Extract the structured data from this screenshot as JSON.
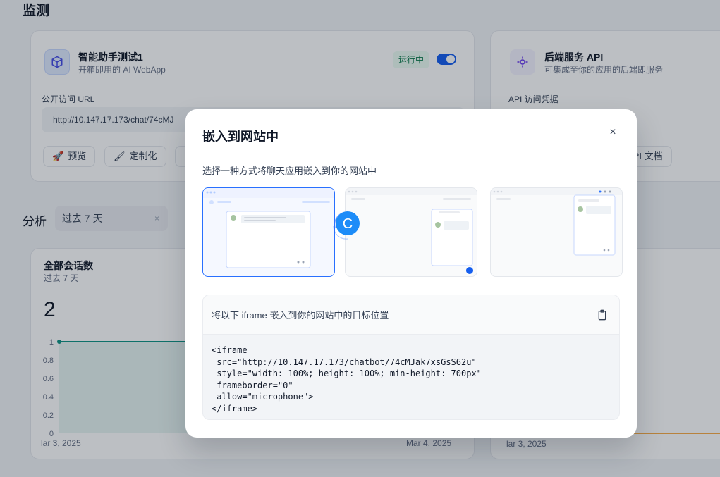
{
  "page": {
    "title": "监测"
  },
  "app_card": {
    "name": "智能助手测试1",
    "subtitle": "开箱即用的 AI WebApp",
    "status": "运行中",
    "url_label": "公开访问 URL",
    "url": "http://10.147.17.173/chat/74cMJ",
    "buttons": {
      "preview": "预览",
      "customize": "定制化"
    }
  },
  "api_card": {
    "name": "后端服务 API",
    "subtitle": "可集成至你的应用的后端即服务",
    "credentials_label": "API 访问凭据",
    "docs": "API 文档"
  },
  "analysis": {
    "label": "分析",
    "period": "过去 7 天",
    "clear": "×"
  },
  "chart_data": {
    "type": "line",
    "title": "全部会话数",
    "subtitle": "过去 7 天",
    "total": "2",
    "y_ticks": [
      "1",
      "0.8",
      "0.6",
      "0.4",
      "0.2",
      "0"
    ],
    "x_labels": [
      "lar 3, 2025",
      "Mar 4, 2025"
    ],
    "second_chart_x_label": "lar 3, 2025",
    "series": [
      {
        "values": [
          1,
          1
        ]
      }
    ],
    "ylim": [
      0,
      1
    ],
    "color": "#0e9384"
  },
  "loader": {
    "letter": "C"
  },
  "modal": {
    "title": "嵌入到网站中",
    "close": "×",
    "description": "选择一种方式将聊天应用嵌入到你的网站中",
    "options": [
      "fullscreen",
      "chat-bubble",
      "chrome-plugin"
    ],
    "selected_option": "fullscreen",
    "code_heading": "将以下 iframe 嵌入到你的网站中的目标位置",
    "code": "<iframe\n src=\"http://10.147.17.173/chatbot/74cMJak7xsGsS62u\"\n style=\"width: 100%; height: 100%; min-height: 700px\"\n frameborder=\"0\"\n allow=\"microphone\">\n</iframe>"
  },
  "colors": {
    "accent": "#2970ff",
    "status_green": "#067647",
    "chart_line": "#0e9384"
  }
}
